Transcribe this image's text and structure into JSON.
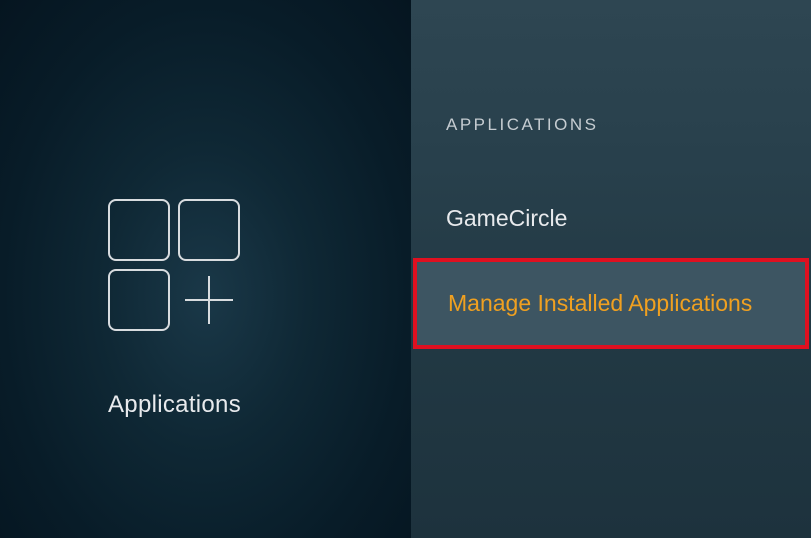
{
  "left": {
    "label": "Applications"
  },
  "right": {
    "section_header": "APPLICATIONS",
    "items": [
      {
        "label": "GameCircle",
        "selected": false
      },
      {
        "label": "Manage Installed Applications",
        "selected": true
      }
    ]
  }
}
